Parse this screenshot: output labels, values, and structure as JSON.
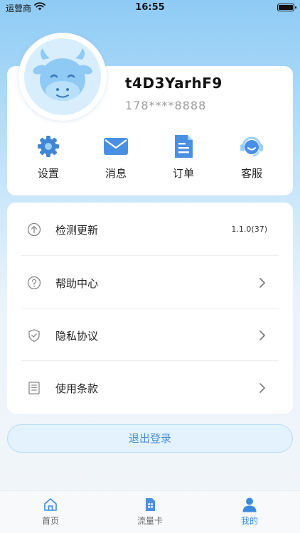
{
  "status_bar": {
    "carrier": "运营商",
    "time": "16:55"
  },
  "profile": {
    "username": "t4D3YarhF9",
    "phone": "178****8888"
  },
  "quick_actions": [
    {
      "label": "设置",
      "icon": "gear-icon"
    },
    {
      "label": "消息",
      "icon": "envelope-icon"
    },
    {
      "label": "订单",
      "icon": "document-icon"
    },
    {
      "label": "客服",
      "icon": "headset-icon"
    }
  ],
  "menu": [
    {
      "label": "检测更新",
      "icon": "arrow-up-circle-icon",
      "value": "1.1.0(37)"
    },
    {
      "label": "帮助中心",
      "icon": "question-circle-icon"
    },
    {
      "label": "隐私协议",
      "icon": "shield-check-icon"
    },
    {
      "label": "使用条款",
      "icon": "document-list-icon"
    }
  ],
  "logout_label": "退出登录",
  "tabs": [
    {
      "label": "首页",
      "icon": "home-icon",
      "active": false
    },
    {
      "label": "流量卡",
      "icon": "sim-card-icon",
      "active": false
    },
    {
      "label": "我的",
      "icon": "person-icon",
      "active": true
    }
  ],
  "colors": {
    "accent": "#3a8be0",
    "icon_blue": "#4a90e2",
    "logout_bg": "#e3f2fd"
  }
}
